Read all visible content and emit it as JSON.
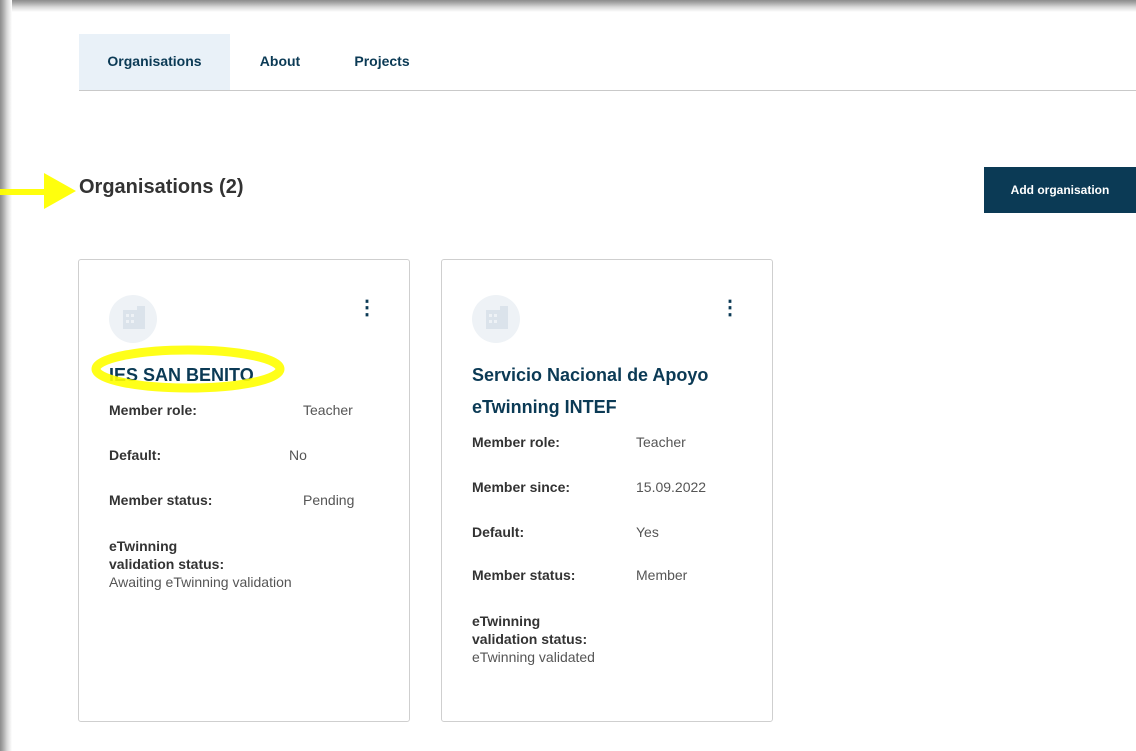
{
  "tabs": [
    {
      "label": "Organisations",
      "active": true
    },
    {
      "label": "About",
      "active": false
    },
    {
      "label": "Projects",
      "active": false
    }
  ],
  "section": {
    "title": "Organisations (2)",
    "add_button": "Add organisation"
  },
  "colors": {
    "primary": "#0b3a55",
    "active_tab_bg": "#e9f1f8",
    "highlighter": "#ffff00"
  },
  "cards": [
    {
      "icon": "building-icon",
      "menu_icon": "kebab-menu-icon",
      "name": "IES SAN BENITO",
      "highlighted": true,
      "fields": [
        {
          "label": "Member role:",
          "value": "Teacher"
        },
        {
          "label": "Default:",
          "value": "No"
        },
        {
          "label": "Member status:",
          "value": "Pending"
        }
      ],
      "validation_label_1": "eTwinning",
      "validation_label_2": "validation status:",
      "validation_value": "Awaiting eTwinning validation"
    },
    {
      "icon": "building-icon",
      "menu_icon": "kebab-menu-icon",
      "name_line1": "Servicio Nacional de Apoyo",
      "name_line2": "eTwinning INTEF",
      "highlighted": false,
      "fields": [
        {
          "label": "Member role:",
          "value": "Teacher"
        },
        {
          "label": "Member since:",
          "value": "15.09.2022"
        },
        {
          "label": "Default:",
          "value": "Yes"
        },
        {
          "label": "Member status:",
          "value": "Member"
        }
      ],
      "validation_label_1": "eTwinning",
      "validation_label_2": "validation status:",
      "validation_value": "eTwinning validated"
    }
  ]
}
